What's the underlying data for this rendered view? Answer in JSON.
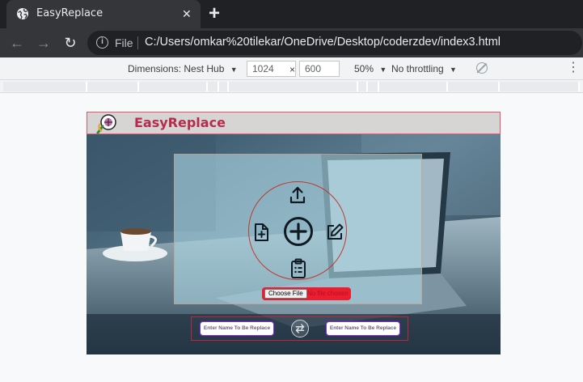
{
  "browser": {
    "tab": {
      "title": "EasyReplace",
      "close_glyph": "✕",
      "favicon": "globe-icon"
    },
    "new_tab_glyph": "+",
    "nav": {
      "back": "←",
      "forward": "→",
      "reload": "↻"
    },
    "address_bar": {
      "info_glyph": "i",
      "scheme_label": "File",
      "url": "C:/Users/omkar%20tilekar/OneDrive/Desktop/coderzdev/index3.html"
    }
  },
  "devtools": {
    "dimensions_label": "Dimensions: Nest Hub",
    "width_value": "1024",
    "times_sign": "×",
    "height_value": "600",
    "zoom_label": "50%",
    "throttle_label": "No throttling",
    "dropdown_glyph": "▼",
    "more_glyph": "⋮"
  },
  "site": {
    "brand_name": "EasyReplace",
    "icons": [
      "upload-icon",
      "file-plus-icon",
      "plus-circle-icon",
      "edit-icon",
      "clipboard-list-icon",
      "swap-icon"
    ],
    "file_input": {
      "button_label": "Choose File",
      "status": "No file chosen"
    },
    "inputs": [
      {
        "placeholder": "Enter Name To Be Replace"
      },
      {
        "placeholder": "Enter Name To Be Replace"
      }
    ]
  },
  "colors": {
    "chrome_dark": "#202124",
    "chrome_tab": "#35363a",
    "brand_text": "#b62d4b",
    "header_border": "#e0566b",
    "file_picker_bg": "#ee1c2e",
    "input_border": "#8a2be2"
  }
}
